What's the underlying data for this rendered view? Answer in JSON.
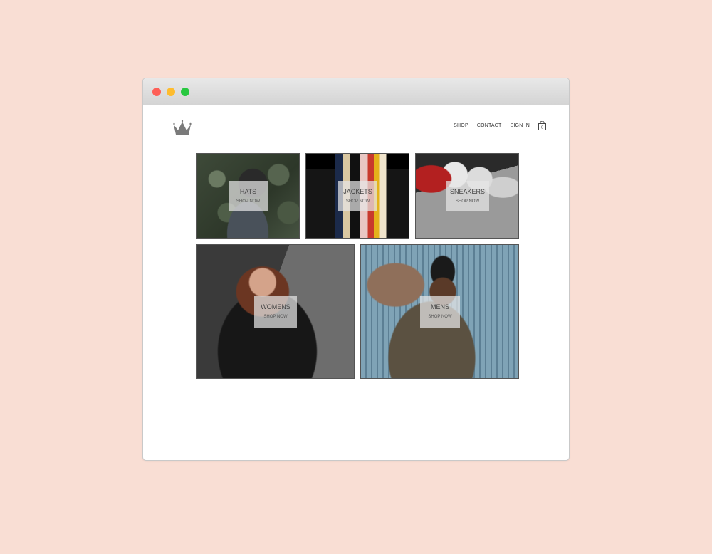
{
  "nav": {
    "items": [
      "SHOP",
      "CONTACT",
      "SIGN IN"
    ],
    "cart_count": "0"
  },
  "categories": [
    {
      "title": "HATS",
      "cta": "SHOP NOW"
    },
    {
      "title": "JACKETS",
      "cta": "SHOP NOW"
    },
    {
      "title": "SNEAKERS",
      "cta": "SHOP NOW"
    },
    {
      "title": "WOMENS",
      "cta": "SHOP NOW"
    },
    {
      "title": "MENS",
      "cta": "SHOP NOW"
    }
  ],
  "icons": {
    "logo": "crown-icon",
    "cart": "shopping-bag-icon"
  },
  "colors": {
    "page_background": "#f9ded4",
    "window_background": "#ffffff",
    "close": "#fe5f57",
    "minimize": "#febc2e",
    "maximize": "#28c840"
  }
}
